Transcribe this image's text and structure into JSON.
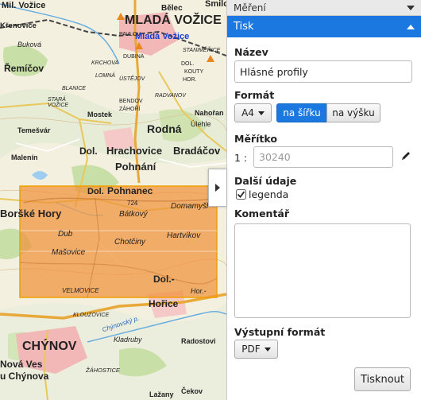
{
  "map": {
    "labels": [
      "Mil. Vožice",
      "Bělec",
      "Smilo",
      "Křenovice",
      "MLADÁ VOŽICE",
      "Mladá Vožice",
      "PAVLOV",
      "STANIMĚŘICE",
      "Buková",
      "Řemíčov",
      "KRCHOVA",
      "DUBINA",
      "DOL.",
      "KOUTY",
      "HOR.",
      "BLANICE",
      "LOMNÁ",
      "ÚSTĚJOV",
      "STARÁ VOŽICE",
      "RADVANOV",
      "Nahořan",
      "BENDOV",
      "ZÁHOŘÍ",
      "Mostek",
      "Úlehle",
      "Temešvár",
      "Rodná",
      "Malenín",
      "Dol.",
      "Hrachovice",
      "Bradáčov",
      "Pohnání",
      "Dol.",
      "Pohnanec",
      "724",
      "Domamyšl",
      "Boršké Hory",
      "Bátkový",
      "Dub",
      "Hartvíkov",
      "Chotčiny",
      "Mašovice",
      "Dol.-",
      "Hor.-",
      "VELMOVICE",
      "Hořice",
      "KLOUZOVICE",
      "Chýnovský p.",
      "Kladruby",
      "Radostovi",
      "CHÝNOV",
      "Nová Ves",
      "u Chýnova",
      "ŽÁHOSTICE",
      "Lažany",
      "Čekov"
    ]
  },
  "panel": {
    "section_mereni": "Měření",
    "section_tisk": "Tisk",
    "nazev_label": "Název",
    "nazev_value": "Hlásné profily",
    "format_label": "Formát",
    "paper_size": "A4",
    "orientation_landscape": "na šířku",
    "orientation_portrait": "na výšku",
    "meritko_label": "Měřítko",
    "scale_prefix": "1 :",
    "scale_placeholder": "30240",
    "dalsi_label": "Další údaje",
    "legenda_label": "legenda",
    "komentar_label": "Komentář",
    "vystup_label": "Výstupní formát",
    "output_format": "PDF",
    "print_button": "Tisknout"
  },
  "colors": {
    "accent": "#1a78e0",
    "print_area": "#f0913a"
  },
  "icons": [
    "expand-panel-icon",
    "chevron-down-icon",
    "chevron-up-icon",
    "pencil-icon",
    "checkbox-icon"
  ]
}
